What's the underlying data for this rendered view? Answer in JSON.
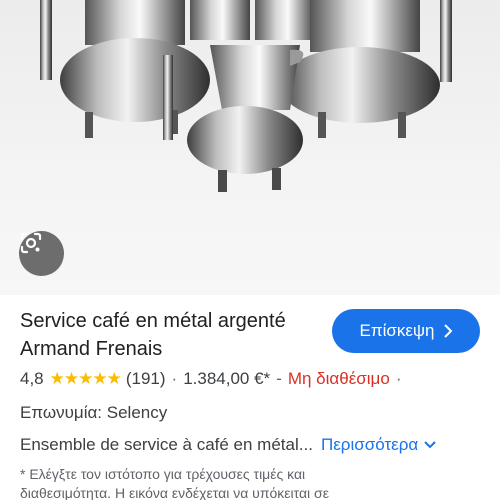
{
  "product": {
    "title": "Service café en métal argenté Armand Frenais",
    "visit_label": "Επίσκεψη",
    "rating": "4,8",
    "stars": "★★★★★",
    "review_count": "(191)",
    "price": "1.384,00 €*",
    "availability": "Μη διαθέσιμο",
    "brand_line": "Επωνυμία: Selency",
    "description": "Ensemble de service à café en métal...",
    "more_label": "Περισσότερα",
    "disclaimer": "* Ελέγξτε τον ιστότοπο για τρέχουσες τιμές και διαθεσιμότητα. Η εικόνα ενδέχεται να υπόκειται σε"
  },
  "icons": {
    "lens": "google-lens-icon",
    "visit_chevron": "chevron-right-icon",
    "more_chevron": "chevron-down-icon"
  },
  "colors": {
    "accent": "#1a73e8",
    "star": "#fbbc04",
    "unavailable": "#d93025"
  }
}
